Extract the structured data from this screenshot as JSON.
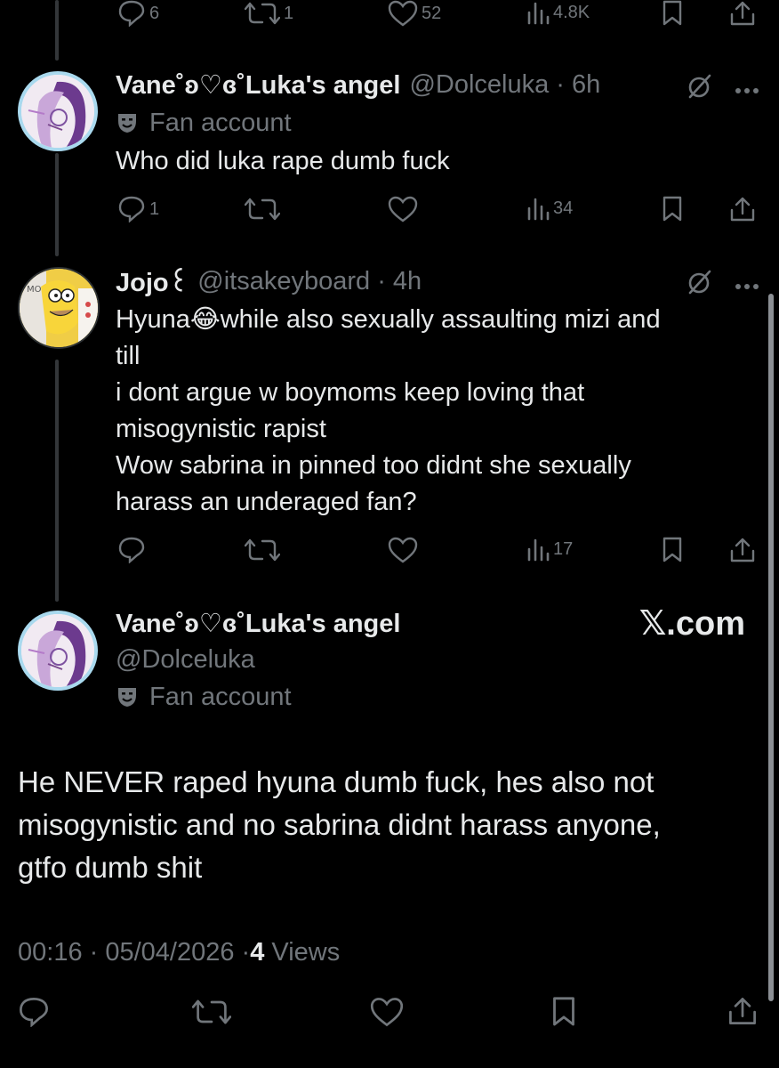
{
  "top_actions": {
    "reply": "6",
    "repost": "1",
    "like": "52",
    "views": "4.8K"
  },
  "reply1": {
    "display_name": "Vane˚ʚ♡ɞ˚Luka's angel",
    "handle_time": "@Dolceluka · 6h",
    "label": "Fan account",
    "text": "Who did luka rape dumb fuck",
    "actions": {
      "reply": "1",
      "views": "34"
    }
  },
  "reply2": {
    "display_name": "Jojo꒰",
    "handle_time": "@itsakeyboard · 4h",
    "lines": [
      "Hyuna😂while also sexually assaulting mizi and",
      "till",
      "i dont argue w boymoms keep loving that",
      "misogynistic rapist",
      "Wow sabrina in pinned too didnt she sexually",
      "harass an underaged fan?"
    ],
    "actions": {
      "views": "17"
    }
  },
  "main": {
    "display_name": "Vane˚ʚ♡ɞ˚Luka's angel",
    "handle": "@Dolceluka",
    "label": "Fan account",
    "watermark": "𝕏.com",
    "lines": [
      "He NEVER raped hyuna dumb fuck, hes also not",
      "misogynistic and no sabrina didnt harass anyone,",
      "gtfo dumb shit"
    ],
    "time": "00:16 · 05/04/2026 · ",
    "views_count": "4",
    "views_label": " Views"
  },
  "colors": {
    "background": "#000000",
    "text": "#e7e9ea",
    "muted": "#71767b",
    "avatar_ring": "#a9d9ee"
  }
}
